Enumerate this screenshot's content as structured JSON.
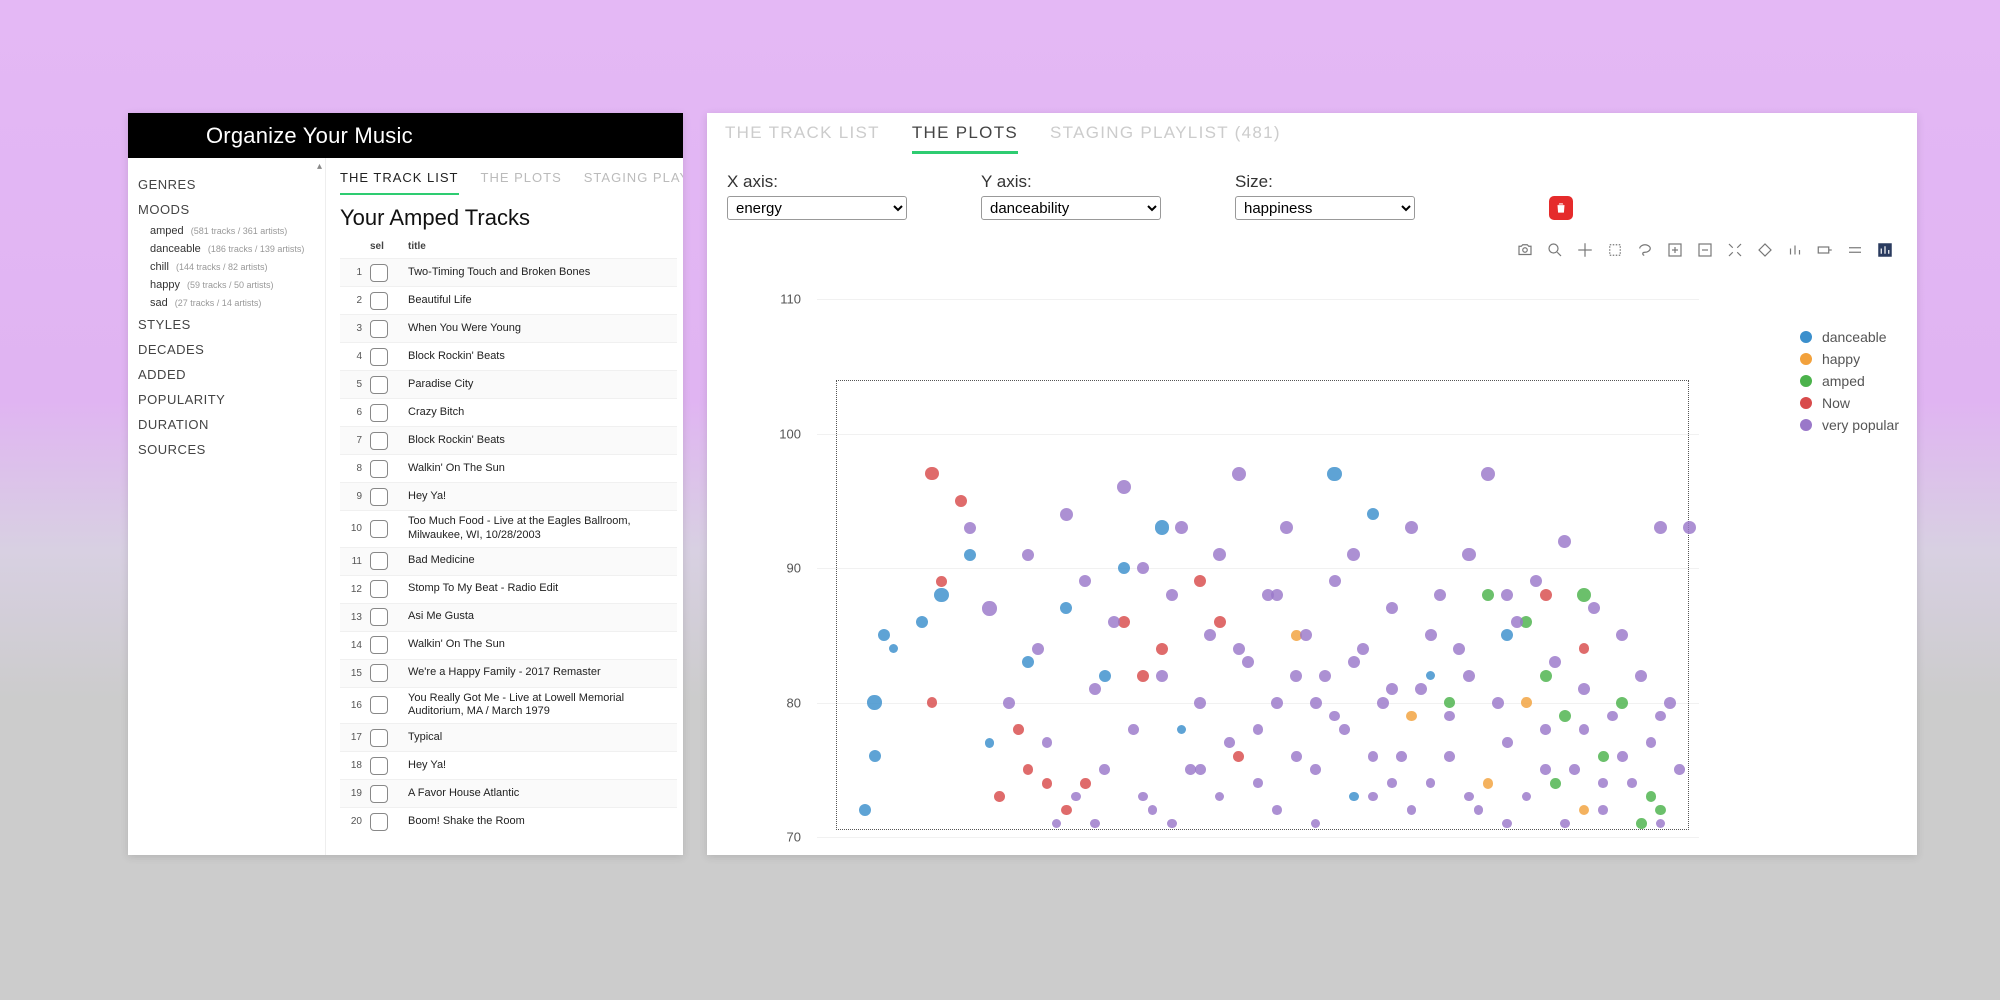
{
  "app_title": "Organize Your Music",
  "left": {
    "tabs": [
      "THE TRACK LIST",
      "THE PLOTS",
      "STAGING PLAYLIST"
    ],
    "active_tab": 0,
    "sidebar": {
      "categories": [
        {
          "label": "GENRES"
        },
        {
          "label": "MOODS",
          "sub": [
            {
              "label": "amped",
              "meta": "(581 tracks / 361 artists)"
            },
            {
              "label": "danceable",
              "meta": "(186 tracks / 139 artists)"
            },
            {
              "label": "chill",
              "meta": "(144 tracks / 82 artists)"
            },
            {
              "label": "happy",
              "meta": "(59 tracks / 50 artists)"
            },
            {
              "label": "sad",
              "meta": "(27 tracks / 14 artists)"
            }
          ]
        },
        {
          "label": "STYLES"
        },
        {
          "label": "DECADES"
        },
        {
          "label": "ADDED"
        },
        {
          "label": "POPULARITY"
        },
        {
          "label": "DURATION"
        },
        {
          "label": "SOURCES"
        }
      ]
    },
    "list_title": "Your Amped Tracks",
    "table_head": {
      "sel": "sel",
      "title": "title"
    },
    "tracks": [
      {
        "n": 1,
        "t": "Two-Timing Touch and Broken Bones"
      },
      {
        "n": 2,
        "t": "Beautiful Life"
      },
      {
        "n": 3,
        "t": "When You Were Young"
      },
      {
        "n": 4,
        "t": "Block Rockin' Beats"
      },
      {
        "n": 5,
        "t": "Paradise City"
      },
      {
        "n": 6,
        "t": "Crazy Bitch"
      },
      {
        "n": 7,
        "t": "Block Rockin' Beats"
      },
      {
        "n": 8,
        "t": "Walkin' On The Sun"
      },
      {
        "n": 9,
        "t": "Hey Ya!"
      },
      {
        "n": 10,
        "t": "Too Much Food - Live at the Eagles Ballroom, Milwaukee, WI, 10/28/2003"
      },
      {
        "n": 11,
        "t": "Bad Medicine"
      },
      {
        "n": 12,
        "t": "Stomp To My Beat - Radio Edit"
      },
      {
        "n": 13,
        "t": "Asi Me Gusta"
      },
      {
        "n": 14,
        "t": "Walkin' On The Sun"
      },
      {
        "n": 15,
        "t": "We're a Happy Family - 2017 Remaster"
      },
      {
        "n": 16,
        "t": "You Really Got Me - Live at Lowell Memorial Auditorium, MA / March 1979"
      },
      {
        "n": 17,
        "t": "Typical"
      },
      {
        "n": 18,
        "t": "Hey Ya!"
      },
      {
        "n": 19,
        "t": "A Favor House Atlantic"
      },
      {
        "n": 20,
        "t": "Boom! Shake the Room"
      }
    ]
  },
  "right": {
    "tabs": [
      "THE TRACK LIST",
      "THE PLOTS",
      "STAGING PLAYLIST (481)"
    ],
    "active_tab": 1,
    "x_label": "X axis:",
    "y_label": "Y axis:",
    "s_label": "Size:",
    "x_sel": "energy",
    "y_sel": "danceability",
    "s_sel": "happiness",
    "legend": [
      {
        "name": "danceable",
        "color": "#3b8fcc"
      },
      {
        "name": "happy",
        "color": "#f2a13c"
      },
      {
        "name": "amped",
        "color": "#4bb24b"
      },
      {
        "name": "Now",
        "color": "#d84b4b"
      },
      {
        "name": "very popular",
        "color": "#9a78c9"
      }
    ],
    "y_ticks": [
      70,
      80,
      90,
      100,
      110
    ]
  },
  "chart_data": {
    "type": "scatter",
    "xlabel": "energy",
    "ylabel": "danceability",
    "size_by": "happiness",
    "ylim": [
      70,
      110
    ],
    "xlim": [
      8,
      100
    ],
    "legend_position": "right",
    "series": [
      {
        "name": "danceable",
        "color": "#3b8fcc",
        "points": [
          {
            "x": 13,
            "y": 72,
            "s": 10
          },
          {
            "x": 14,
            "y": 76,
            "s": 10
          },
          {
            "x": 14,
            "y": 80,
            "s": 12
          },
          {
            "x": 15,
            "y": 85,
            "s": 10
          },
          {
            "x": 16,
            "y": 84,
            "s": 8
          },
          {
            "x": 19,
            "y": 86,
            "s": 10
          },
          {
            "x": 21,
            "y": 88,
            "s": 12
          },
          {
            "x": 24,
            "y": 91,
            "s": 10
          },
          {
            "x": 26,
            "y": 77,
            "s": 8
          },
          {
            "x": 30,
            "y": 83,
            "s": 10
          },
          {
            "x": 34,
            "y": 87,
            "s": 10
          },
          {
            "x": 38,
            "y": 82,
            "s": 10
          },
          {
            "x": 40,
            "y": 90,
            "s": 10
          },
          {
            "x": 44,
            "y": 93,
            "s": 12
          },
          {
            "x": 46,
            "y": 78,
            "s": 8
          },
          {
            "x": 62,
            "y": 97,
            "s": 12
          },
          {
            "x": 66,
            "y": 94,
            "s": 10
          },
          {
            "x": 72,
            "y": 82,
            "s": 8
          },
          {
            "x": 80,
            "y": 85,
            "s": 10
          },
          {
            "x": 64,
            "y": 73,
            "s": 8
          }
        ]
      },
      {
        "name": "happy",
        "color": "#f2a13c",
        "points": [
          {
            "x": 58,
            "y": 85,
            "s": 9
          },
          {
            "x": 70,
            "y": 79,
            "s": 9
          },
          {
            "x": 78,
            "y": 74,
            "s": 9
          },
          {
            "x": 82,
            "y": 80,
            "s": 9
          },
          {
            "x": 88,
            "y": 72,
            "s": 9
          }
        ]
      },
      {
        "name": "amped",
        "color": "#4bb24b",
        "points": [
          {
            "x": 78,
            "y": 88,
            "s": 10
          },
          {
            "x": 82,
            "y": 86,
            "s": 10
          },
          {
            "x": 84,
            "y": 82,
            "s": 10
          },
          {
            "x": 86,
            "y": 79,
            "s": 10
          },
          {
            "x": 88,
            "y": 88,
            "s": 12
          },
          {
            "x": 90,
            "y": 76,
            "s": 9
          },
          {
            "x": 92,
            "y": 80,
            "s": 10
          },
          {
            "x": 94,
            "y": 71,
            "s": 9
          },
          {
            "x": 95,
            "y": 73,
            "s": 9
          },
          {
            "x": 96,
            "y": 72,
            "s": 9
          },
          {
            "x": 85,
            "y": 74,
            "s": 9
          },
          {
            "x": 74,
            "y": 80,
            "s": 9
          }
        ]
      },
      {
        "name": "Now",
        "color": "#d84b4b",
        "points": [
          {
            "x": 20,
            "y": 97,
            "s": 11
          },
          {
            "x": 21,
            "y": 89,
            "s": 9
          },
          {
            "x": 23,
            "y": 95,
            "s": 10
          },
          {
            "x": 27,
            "y": 73,
            "s": 9
          },
          {
            "x": 29,
            "y": 78,
            "s": 9
          },
          {
            "x": 30,
            "y": 75,
            "s": 9
          },
          {
            "x": 32,
            "y": 74,
            "s": 9
          },
          {
            "x": 34,
            "y": 72,
            "s": 9
          },
          {
            "x": 36,
            "y": 74,
            "s": 9
          },
          {
            "x": 40,
            "y": 86,
            "s": 10
          },
          {
            "x": 42,
            "y": 82,
            "s": 10
          },
          {
            "x": 44,
            "y": 84,
            "s": 10
          },
          {
            "x": 48,
            "y": 89,
            "s": 10
          },
          {
            "x": 50,
            "y": 86,
            "s": 10
          },
          {
            "x": 52,
            "y": 76,
            "s": 9
          },
          {
            "x": 84,
            "y": 88,
            "s": 10
          },
          {
            "x": 88,
            "y": 84,
            "s": 9
          },
          {
            "x": 20,
            "y": 80,
            "s": 9
          }
        ]
      },
      {
        "name": "very popular",
        "color": "#9a78c9",
        "points": [
          {
            "x": 24,
            "y": 93,
            "s": 10
          },
          {
            "x": 26,
            "y": 87,
            "s": 12
          },
          {
            "x": 28,
            "y": 80,
            "s": 10
          },
          {
            "x": 30,
            "y": 91,
            "s": 10
          },
          {
            "x": 31,
            "y": 84,
            "s": 10
          },
          {
            "x": 32,
            "y": 77,
            "s": 9
          },
          {
            "x": 34,
            "y": 94,
            "s": 11
          },
          {
            "x": 35,
            "y": 73,
            "s": 8
          },
          {
            "x": 36,
            "y": 89,
            "s": 10
          },
          {
            "x": 37,
            "y": 81,
            "s": 10
          },
          {
            "x": 38,
            "y": 75,
            "s": 9
          },
          {
            "x": 39,
            "y": 86,
            "s": 10
          },
          {
            "x": 40,
            "y": 96,
            "s": 12
          },
          {
            "x": 41,
            "y": 78,
            "s": 9
          },
          {
            "x": 42,
            "y": 90,
            "s": 10
          },
          {
            "x": 43,
            "y": 72,
            "s": 8
          },
          {
            "x": 44,
            "y": 82,
            "s": 10
          },
          {
            "x": 45,
            "y": 88,
            "s": 10
          },
          {
            "x": 46,
            "y": 93,
            "s": 11
          },
          {
            "x": 47,
            "y": 75,
            "s": 9
          },
          {
            "x": 48,
            "y": 80,
            "s": 10
          },
          {
            "x": 49,
            "y": 85,
            "s": 10
          },
          {
            "x": 50,
            "y": 91,
            "s": 11
          },
          {
            "x": 51,
            "y": 77,
            "s": 9
          },
          {
            "x": 52,
            "y": 97,
            "s": 12
          },
          {
            "x": 53,
            "y": 83,
            "s": 10
          },
          {
            "x": 54,
            "y": 74,
            "s": 8
          },
          {
            "x": 55,
            "y": 88,
            "s": 10
          },
          {
            "x": 56,
            "y": 80,
            "s": 10
          },
          {
            "x": 57,
            "y": 93,
            "s": 11
          },
          {
            "x": 58,
            "y": 76,
            "s": 9
          },
          {
            "x": 59,
            "y": 85,
            "s": 10
          },
          {
            "x": 60,
            "y": 71,
            "s": 8
          },
          {
            "x": 61,
            "y": 82,
            "s": 10
          },
          {
            "x": 62,
            "y": 89,
            "s": 10
          },
          {
            "x": 63,
            "y": 78,
            "s": 9
          },
          {
            "x": 64,
            "y": 91,
            "s": 11
          },
          {
            "x": 65,
            "y": 84,
            "s": 10
          },
          {
            "x": 66,
            "y": 73,
            "s": 8
          },
          {
            "x": 67,
            "y": 80,
            "s": 10
          },
          {
            "x": 68,
            "y": 87,
            "s": 10
          },
          {
            "x": 69,
            "y": 76,
            "s": 9
          },
          {
            "x": 70,
            "y": 93,
            "s": 11
          },
          {
            "x": 71,
            "y": 81,
            "s": 10
          },
          {
            "x": 72,
            "y": 74,
            "s": 8
          },
          {
            "x": 73,
            "y": 88,
            "s": 10
          },
          {
            "x": 74,
            "y": 79,
            "s": 9
          },
          {
            "x": 75,
            "y": 84,
            "s": 10
          },
          {
            "x": 76,
            "y": 91,
            "s": 11
          },
          {
            "x": 77,
            "y": 72,
            "s": 8
          },
          {
            "x": 78,
            "y": 97,
            "s": 12
          },
          {
            "x": 79,
            "y": 80,
            "s": 10
          },
          {
            "x": 80,
            "y": 77,
            "s": 9
          },
          {
            "x": 81,
            "y": 86,
            "s": 10
          },
          {
            "x": 82,
            "y": 73,
            "s": 8
          },
          {
            "x": 83,
            "y": 89,
            "s": 10
          },
          {
            "x": 84,
            "y": 78,
            "s": 9
          },
          {
            "x": 85,
            "y": 83,
            "s": 10
          },
          {
            "x": 86,
            "y": 92,
            "s": 11
          },
          {
            "x": 87,
            "y": 75,
            "s": 9
          },
          {
            "x": 88,
            "y": 81,
            "s": 10
          },
          {
            "x": 89,
            "y": 87,
            "s": 10
          },
          {
            "x": 90,
            "y": 72,
            "s": 8
          },
          {
            "x": 91,
            "y": 79,
            "s": 9
          },
          {
            "x": 92,
            "y": 85,
            "s": 10
          },
          {
            "x": 93,
            "y": 74,
            "s": 8
          },
          {
            "x": 94,
            "y": 82,
            "s": 10
          },
          {
            "x": 95,
            "y": 77,
            "s": 9
          },
          {
            "x": 96,
            "y": 93,
            "s": 11
          },
          {
            "x": 97,
            "y": 80,
            "s": 10
          },
          {
            "x": 98,
            "y": 75,
            "s": 9
          },
          {
            "x": 99,
            "y": 93,
            "s": 11
          },
          {
            "x": 33,
            "y": 71,
            "s": 8
          },
          {
            "x": 37,
            "y": 71,
            "s": 8
          },
          {
            "x": 45,
            "y": 71,
            "s": 8
          },
          {
            "x": 50,
            "y": 73,
            "s": 8
          },
          {
            "x": 56,
            "y": 72,
            "s": 8
          },
          {
            "x": 60,
            "y": 75,
            "s": 9
          },
          {
            "x": 66,
            "y": 76,
            "s": 9
          },
          {
            "x": 70,
            "y": 72,
            "s": 8
          },
          {
            "x": 76,
            "y": 73,
            "s": 8
          },
          {
            "x": 80,
            "y": 71,
            "s": 8
          },
          {
            "x": 86,
            "y": 71,
            "s": 8
          },
          {
            "x": 90,
            "y": 74,
            "s": 8
          },
          {
            "x": 96,
            "y": 71,
            "s": 8
          },
          {
            "x": 42,
            "y": 73,
            "s": 8
          },
          {
            "x": 48,
            "y": 75,
            "s": 9
          },
          {
            "x": 54,
            "y": 78,
            "s": 9
          },
          {
            "x": 58,
            "y": 82,
            "s": 10
          },
          {
            "x": 62,
            "y": 79,
            "s": 9
          },
          {
            "x": 68,
            "y": 74,
            "s": 8
          },
          {
            "x": 74,
            "y": 76,
            "s": 9
          },
          {
            "x": 52,
            "y": 84,
            "s": 10
          },
          {
            "x": 56,
            "y": 88,
            "s": 10
          },
          {
            "x": 60,
            "y": 80,
            "s": 10
          },
          {
            "x": 64,
            "y": 83,
            "s": 10
          },
          {
            "x": 68,
            "y": 81,
            "s": 10
          },
          {
            "x": 72,
            "y": 85,
            "s": 10
          },
          {
            "x": 76,
            "y": 82,
            "s": 10
          },
          {
            "x": 80,
            "y": 88,
            "s": 10
          },
          {
            "x": 84,
            "y": 75,
            "s": 9
          },
          {
            "x": 88,
            "y": 78,
            "s": 9
          },
          {
            "x": 92,
            "y": 76,
            "s": 9
          },
          {
            "x": 96,
            "y": 79,
            "s": 9
          }
        ]
      }
    ]
  }
}
